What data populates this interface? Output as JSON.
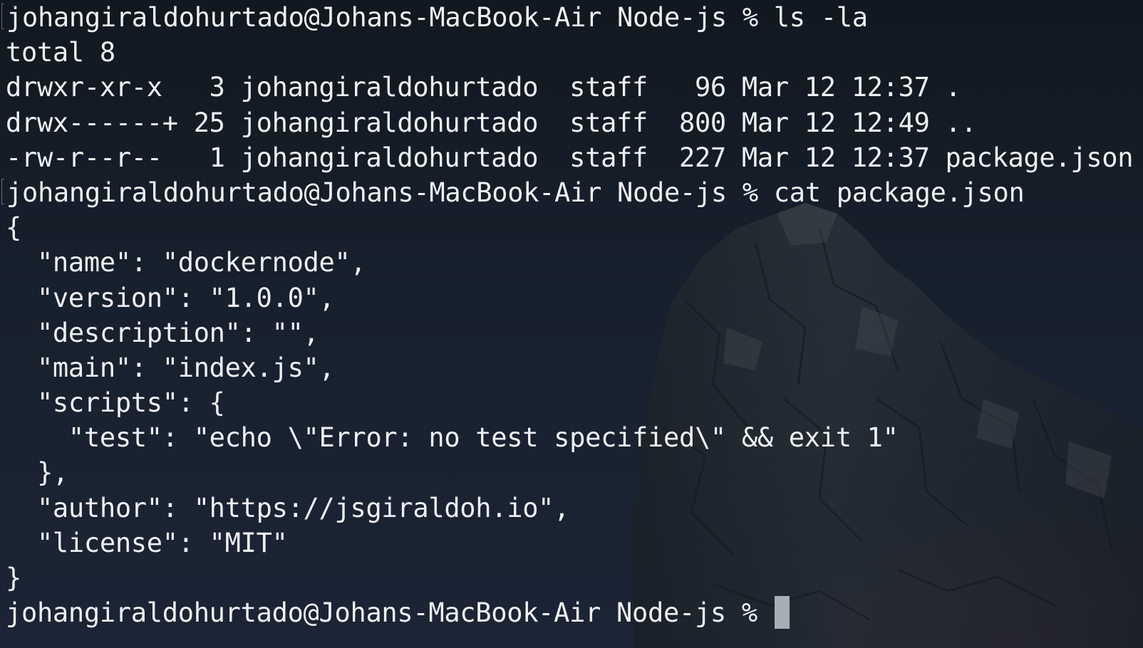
{
  "terminal": {
    "lines": [
      {
        "kind": "command",
        "prompt": "johangiraldohurtado@Johans-MacBook-Air Node-js % ",
        "command": "ls -la"
      },
      {
        "kind": "output",
        "text": "total 8"
      },
      {
        "kind": "output",
        "text": "drwxr-xr-x   3 johangiraldohurtado  staff   96 Mar 12 12:37 ."
      },
      {
        "kind": "output",
        "text": "drwx------+ 25 johangiraldohurtado  staff  800 Mar 12 12:49 .."
      },
      {
        "kind": "output",
        "text": "-rw-r--r--   1 johangiraldohurtado  staff  227 Mar 12 12:37 package.json"
      },
      {
        "kind": "command",
        "prompt": "johangiraldohurtado@Johans-MacBook-Air Node-js % ",
        "command": "cat package.json"
      },
      {
        "kind": "output",
        "text": "{"
      },
      {
        "kind": "output",
        "text": "  \"name\": \"dockernode\","
      },
      {
        "kind": "output",
        "text": "  \"version\": \"1.0.0\","
      },
      {
        "kind": "output",
        "text": "  \"description\": \"\","
      },
      {
        "kind": "output",
        "text": "  \"main\": \"index.js\","
      },
      {
        "kind": "output",
        "text": "  \"scripts\": {"
      },
      {
        "kind": "output",
        "text": "    \"test\": \"echo \\\"Error: no test specified\\\" && exit 1\""
      },
      {
        "kind": "output",
        "text": "  },"
      },
      {
        "kind": "output",
        "text": "  \"author\": \"https://jsgiraldoh.io\","
      },
      {
        "kind": "output",
        "text": "  \"license\": \"MIT\""
      },
      {
        "kind": "output",
        "text": "}"
      }
    ],
    "active_prompt": "johangiraldohurtado@Johans-MacBook-Air Node-js % ",
    "colors": {
      "text": "#eef0f4",
      "cursor": "#a9adb4",
      "background": "#17202d"
    }
  }
}
